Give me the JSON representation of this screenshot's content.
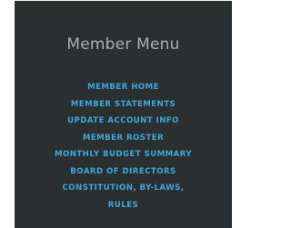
{
  "menu": {
    "title": "Member Menu",
    "items": [
      {
        "label": "MEMBER HOME"
      },
      {
        "label": "MEMBER STATEMENTS"
      },
      {
        "label": "UPDATE ACCOUNT INFO"
      },
      {
        "label": "MEMBER ROSTER"
      },
      {
        "label": "MONTHLY BUDGET SUMMARY"
      },
      {
        "label": "BOARD OF DIRECTORS"
      },
      {
        "label": "CONSTITUTION, BY-LAWS,"
      },
      {
        "label": "RULES"
      }
    ]
  },
  "colors": {
    "panel_bg": "#2b2f2f",
    "title_text": "#a9b0b0",
    "link_text": "#3ea6df"
  }
}
